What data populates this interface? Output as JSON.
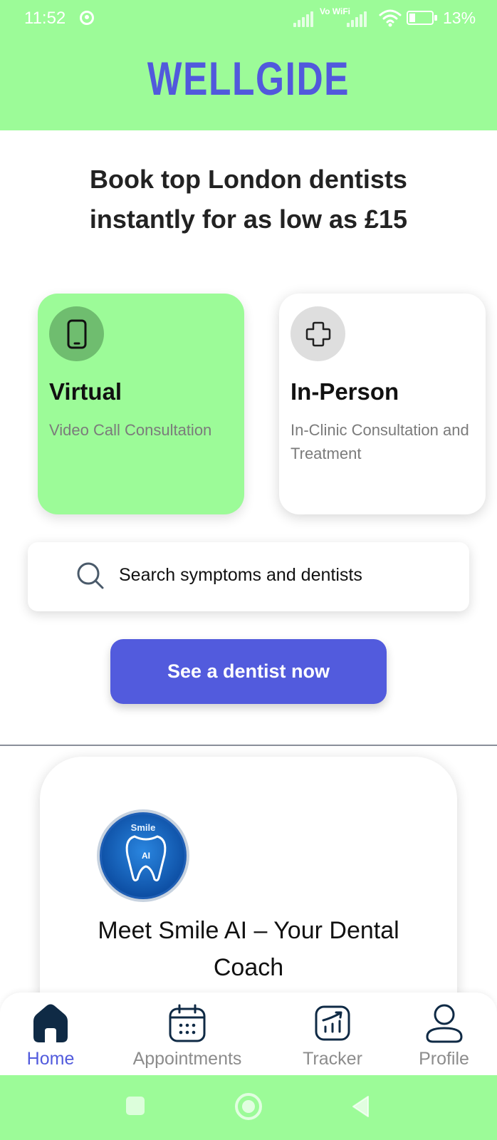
{
  "status_bar": {
    "time": "11:52",
    "network_label": "Vo WiFi",
    "battery_percent": "13%",
    "battery_level": 0.13
  },
  "header": {
    "logo": "WELLGIDE"
  },
  "headline": "Book top London dentists instantly for as low as £15",
  "cards": {
    "virtual": {
      "title": "Virtual",
      "subtitle": "Video Call Consultation",
      "icon": "phone-icon"
    },
    "in_person": {
      "title": "In-Person",
      "subtitle": "In-Clinic Consultation and Treatment",
      "icon": "plus-icon"
    }
  },
  "search": {
    "text": "Search symptoms and dentists",
    "icon": "search-icon"
  },
  "cta": {
    "label": "See a dentist now"
  },
  "smile_ai": {
    "badge_top": "Smile",
    "badge_center": "AI",
    "title": "Meet Smile AI – Your Dental Coach"
  },
  "bottom_nav": {
    "items": [
      {
        "label": "Home",
        "icon": "home-icon",
        "active": true
      },
      {
        "label": "Appointments",
        "icon": "calendar-icon",
        "active": false
      },
      {
        "label": "Tracker",
        "icon": "chart-icon",
        "active": false
      },
      {
        "label": "Profile",
        "icon": "user-icon",
        "active": false
      }
    ]
  },
  "colors": {
    "brand_green": "#9cfb98",
    "brand_blue": "#525bdd",
    "icon_dark": "#0f2a45"
  }
}
